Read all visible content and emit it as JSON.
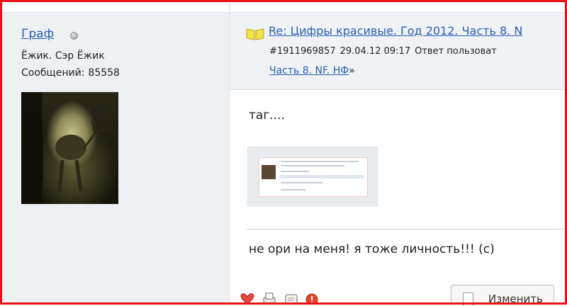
{
  "user": {
    "name": "Граф",
    "title": "Ёжик. Сэр Ёжик",
    "messages_label": "Сообщений:",
    "messages_count": "85558"
  },
  "post": {
    "thread_title": "Re: Цифры красивые. Год 2012. Часть 8. N",
    "post_id": "#1911969857",
    "datetime": "29.04.12 09:17",
    "reply_text": "Ответ пользоват",
    "subtitle_link": "Часть 8. NF. НФ",
    "subtitle_suffix": "»",
    "body_line_1": "таг....",
    "body_line_2": "не ори на меня! я тоже личность!!! (с)"
  },
  "actions": {
    "icons": [
      "heart-icon",
      "print-icon",
      "quote-icon",
      "alert-icon"
    ],
    "edit_label": "Изменить"
  },
  "colors": {
    "frame": "#e8121a",
    "link": "#2a5db0",
    "sidebar_bg": "#eef1f4"
  }
}
